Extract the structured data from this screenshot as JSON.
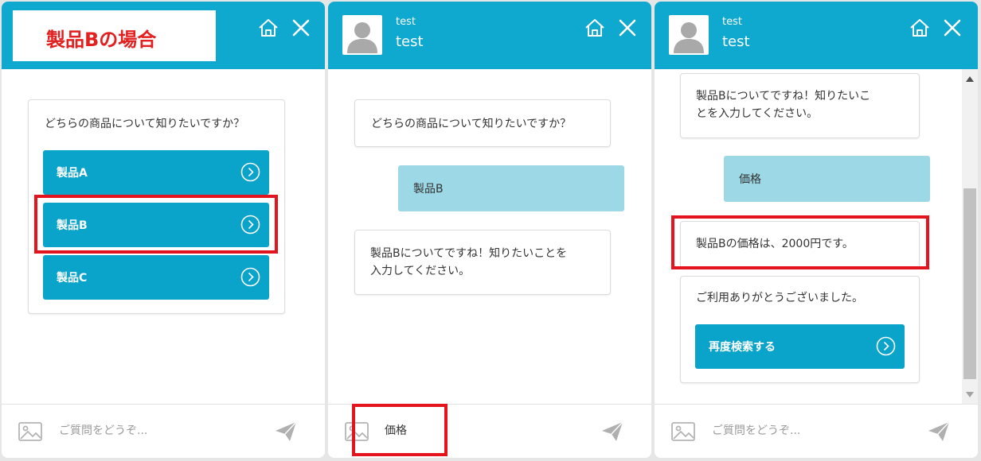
{
  "panel1": {
    "title_label": "製品Bの場合",
    "question": "どちらの商品について知りたいですか？",
    "options": [
      {
        "label": "製品A"
      },
      {
        "label": "製品B"
      },
      {
        "label": "製品C"
      }
    ],
    "input_placeholder": "ご質問をどうぞ..."
  },
  "panel2": {
    "bot_name_small": "test",
    "bot_name": "test",
    "question": "どちらの商品について知りたいですか？",
    "user_message": "製品B",
    "reply_line1": "製品Bについてですね！知りたいことを",
    "reply_line2": "入力してください。",
    "input_value": "価格"
  },
  "panel3": {
    "bot_name_small": "test",
    "bot_name": "test",
    "reply_line1": "製品Bについてですね！知りたいこ",
    "reply_line2": "とを入力してください。",
    "user_message": "価格",
    "answer": "製品Bの価格は、2000円です。",
    "thanks": "ご利用ありがとうございました。",
    "research_button": "再度検索する",
    "input_placeholder": "ご質問をどうぞ..."
  },
  "icons": {
    "home": "home-icon",
    "close": "close-icon",
    "arrow": "arrow-circle-right-icon",
    "image": "image-icon",
    "send": "send-icon",
    "avatar": "avatar-icon"
  },
  "colors": {
    "header": "#0fa8cf",
    "option_button": "#0aa3c9",
    "user_bubble": "#9cd8e6",
    "highlight": "#e4141e",
    "title_text": "#e32020"
  }
}
